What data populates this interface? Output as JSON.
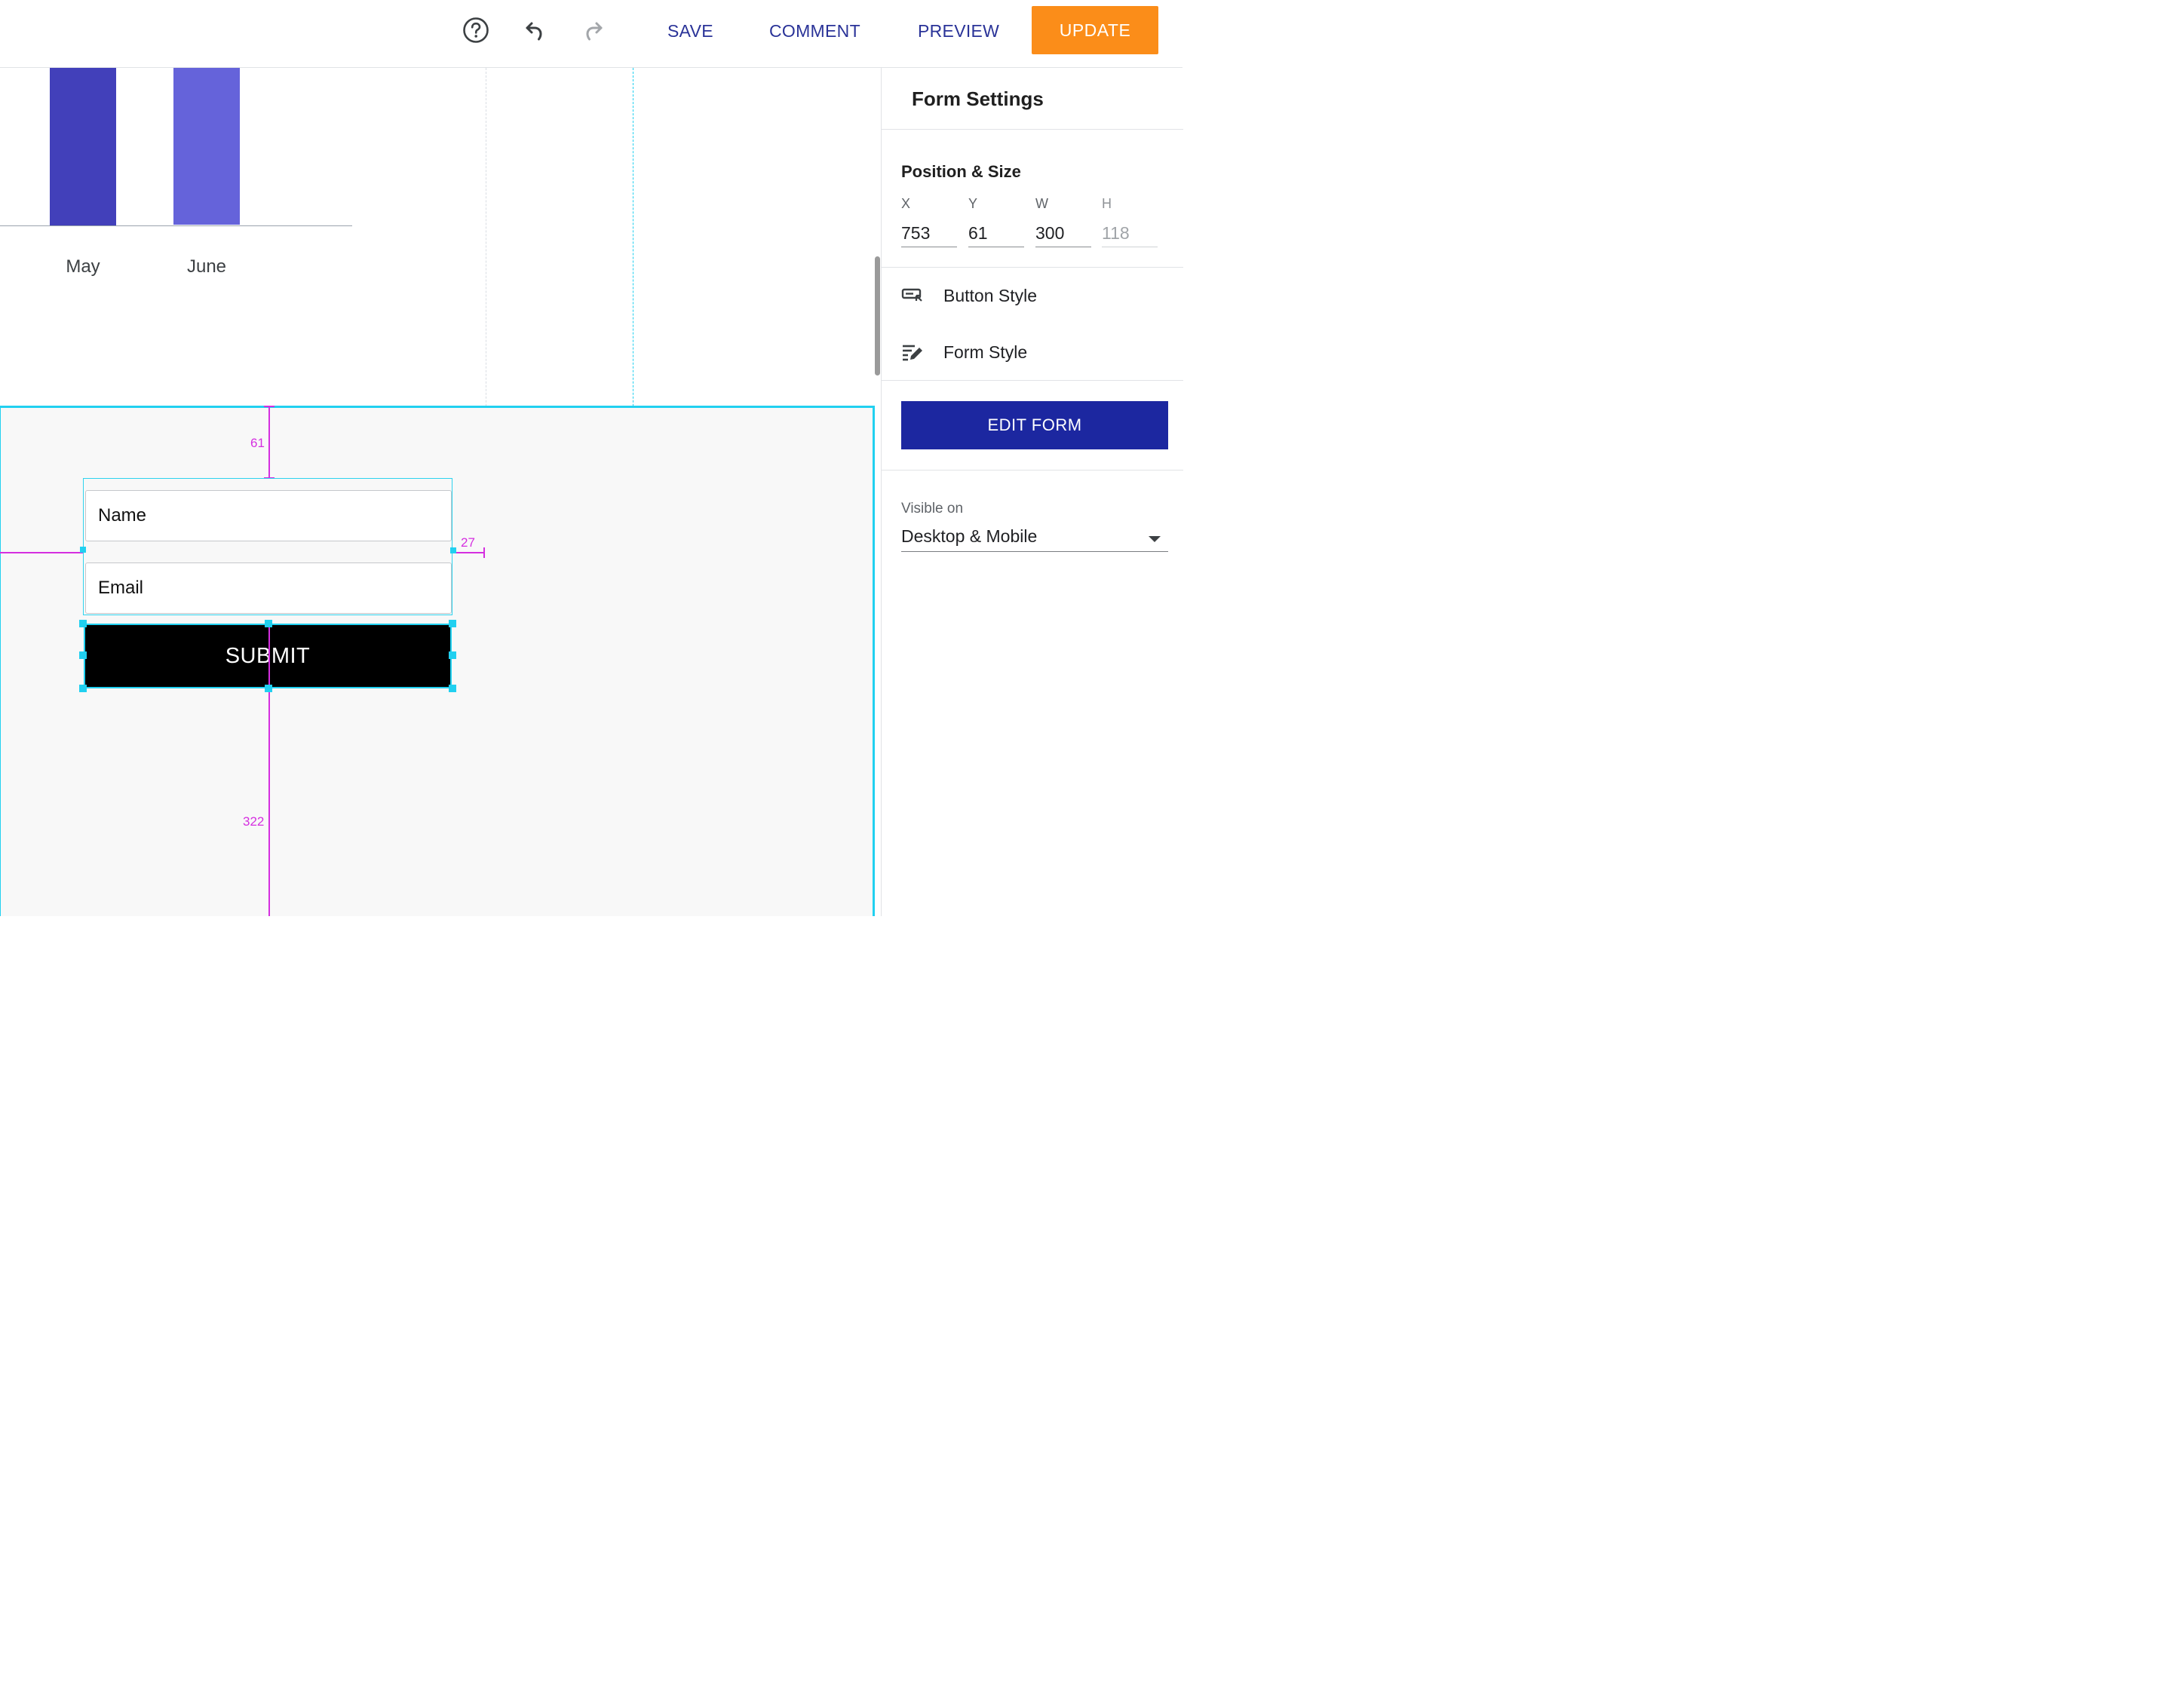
{
  "toolbar": {
    "icons": [
      "help-icon",
      "undo-icon",
      "redo-icon"
    ],
    "save_label": "SAVE",
    "comment_label": "COMMENT",
    "preview_label": "PREVIEW",
    "update_label": "UPDATE"
  },
  "chart_data": {
    "type": "bar",
    "categories": [
      "May",
      "June"
    ],
    "colors": [
      "#4240ba",
      "#6563da"
    ]
  },
  "canvas": {
    "form": {
      "name_label": "Name",
      "email_label": "Email",
      "submit_label": "SUBMIT"
    },
    "measurements": {
      "top": "61",
      "right": "27",
      "bottom": "322"
    }
  },
  "panel": {
    "title": "Form Settings",
    "position_size": {
      "heading": "Position & Size",
      "x_label": "X",
      "x_value": "753",
      "y_label": "Y",
      "y_value": "61",
      "w_label": "W",
      "w_value": "300",
      "h_label": "H",
      "h_value": "118"
    },
    "menu": {
      "button_style": "Button Style",
      "form_style": "Form Style"
    },
    "edit_form_label": "EDIT FORM",
    "visibility": {
      "label": "Visible on",
      "value": "Desktop & Mobile"
    }
  },
  "colors": {
    "accent_orange": "#fb8d19",
    "primary_blue": "#1c27a0",
    "link_blue": "#2a3398",
    "selection_cyan": "#21d0f0",
    "measure_magenta": "#d52fe0"
  }
}
